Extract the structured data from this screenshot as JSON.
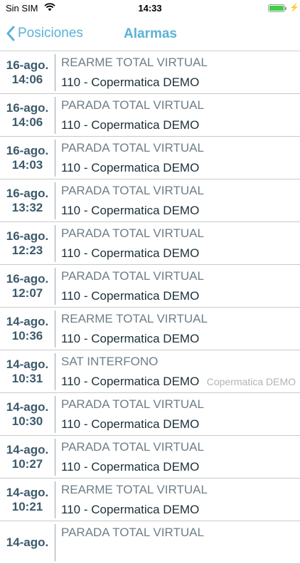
{
  "status_bar": {
    "carrier": "Sin SIM",
    "time": "14:33",
    "battery_level": 1.0,
    "battery_color": "#3fcf46",
    "wifi_icon": "wifi-icon",
    "charging_icon": "bolt-icon"
  },
  "nav": {
    "back_label": "Posiciones",
    "title": "Alarmas",
    "accent_color": "#5ab2d6"
  },
  "alarms": [
    {
      "date": "16-ago.",
      "time": "14:06",
      "type": "REARME TOTAL VIRTUAL",
      "site": "110 - Copermatica DEMO",
      "detail": ""
    },
    {
      "date": "16-ago.",
      "time": "14:06",
      "type": "PARADA TOTAL VIRTUAL",
      "site": "110 - Copermatica DEMO",
      "detail": ""
    },
    {
      "date": "16-ago.",
      "time": "14:03",
      "type": "PARADA TOTAL VIRTUAL",
      "site": "110 - Copermatica DEMO",
      "detail": ""
    },
    {
      "date": "16-ago.",
      "time": "13:32",
      "type": "PARADA TOTAL VIRTUAL",
      "site": "110 - Copermatica DEMO",
      "detail": ""
    },
    {
      "date": "16-ago.",
      "time": "12:23",
      "type": "PARADA TOTAL VIRTUAL",
      "site": "110 - Copermatica DEMO",
      "detail": ""
    },
    {
      "date": "16-ago.",
      "time": "12:07",
      "type": "PARADA TOTAL VIRTUAL",
      "site": "110 - Copermatica DEMO",
      "detail": ""
    },
    {
      "date": "14-ago.",
      "time": "10:36",
      "type": "REARME TOTAL VIRTUAL",
      "site": "110 - Copermatica DEMO",
      "detail": ""
    },
    {
      "date": "14-ago.",
      "time": "10:31",
      "type": "SAT INTERFONO",
      "site": "110 - Copermatica DEMO",
      "detail": "Copermatica DEMO"
    },
    {
      "date": "14-ago.",
      "time": "10:30",
      "type": "PARADA TOTAL VIRTUAL",
      "site": "110 - Copermatica DEMO",
      "detail": ""
    },
    {
      "date": "14-ago.",
      "time": "10:27",
      "type": "PARADA TOTAL VIRTUAL",
      "site": "110 - Copermatica DEMO",
      "detail": ""
    },
    {
      "date": "14-ago.",
      "time": "10:21",
      "type": "REARME TOTAL VIRTUAL",
      "site": "110 - Copermatica DEMO",
      "detail": ""
    },
    {
      "date": "14-ago.",
      "time": "",
      "type": "PARADA TOTAL VIRTUAL",
      "site": "",
      "detail": ""
    }
  ]
}
